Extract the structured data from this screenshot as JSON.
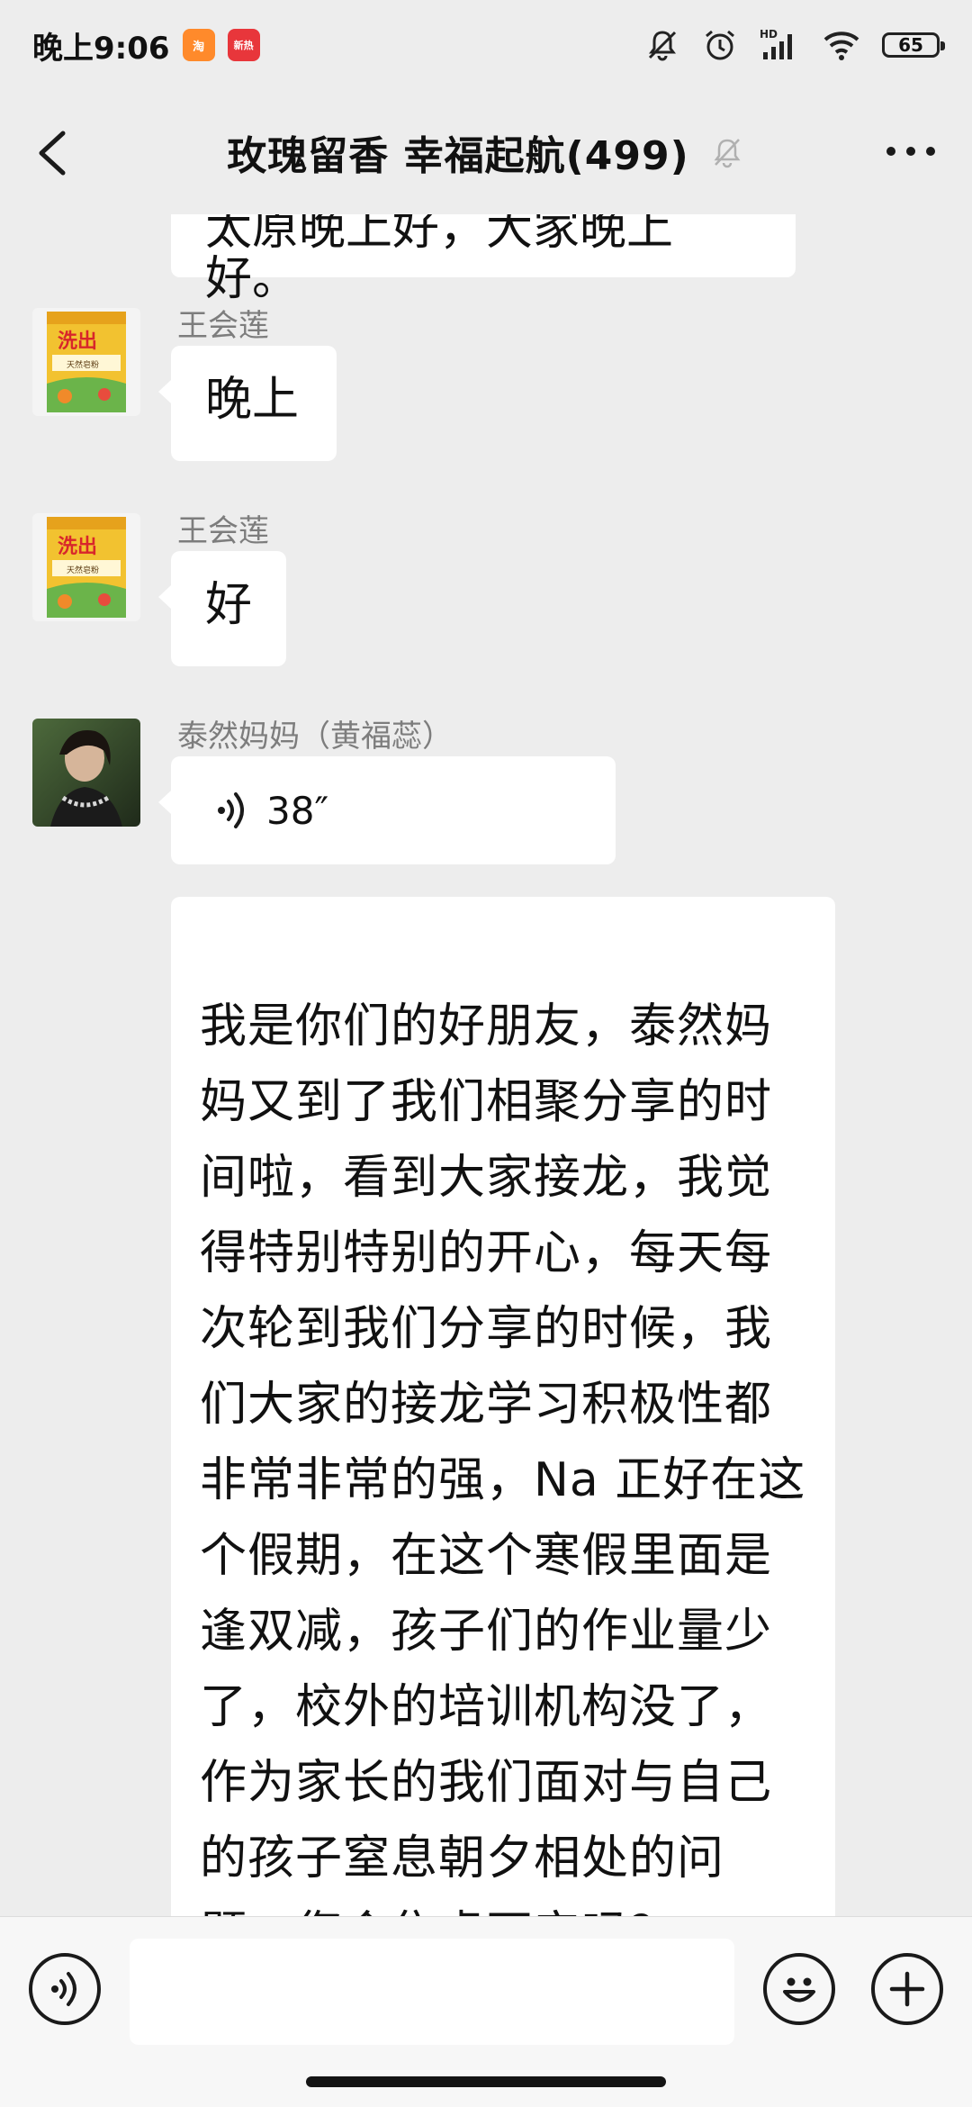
{
  "status_bar": {
    "time": "晚上9:06",
    "app_badges": [
      {
        "name": "taobao-app-icon",
        "color": "#ff8a2b",
        "text": "淘"
      },
      {
        "name": "news-app-icon",
        "color": "#e8363b",
        "text": "新热"
      }
    ],
    "icons": [
      "mute-icon",
      "alarm-icon",
      "signal-hd-icon",
      "wifi-icon"
    ],
    "battery": "65"
  },
  "nav": {
    "title": "玫瑰留香  幸福起航(499)",
    "icons": [
      "back-icon",
      "muted-bell-icon",
      "more-icon"
    ]
  },
  "messages": [
    {
      "type": "text",
      "text": "太原晚上好，大家晚上好。"
    },
    {
      "type": "text",
      "sender": "王会莲",
      "avatar": "rice-bag-avatar",
      "text": "晚上"
    },
    {
      "type": "text",
      "sender": "王会莲",
      "avatar": "rice-bag-avatar",
      "text": "好"
    },
    {
      "type": "voice",
      "sender": "泰然妈妈（黄福蕊）",
      "avatar": "woman-photo-avatar",
      "duration": "38″"
    },
    {
      "type": "text",
      "text": "我是你们的好朋友，泰然妈妈又到了我们相聚分享的时间啦，看到大家接龙，我觉得特别特别的开心，每天每次轮到我们分享的时候，我们大家的接龙学习积极性都非常非常的强，Na 正好在这个假期，在这个寒假里面是逢双减，孩子们的作业量少了，校外的培训机构没了，作为家长的我们面对与自己的孩子窒息朝夕相处的问题，您会焦虑不安吗？"
    }
  ],
  "input_bar": {
    "placeholder": "",
    "icons": [
      "voice-input-icon",
      "emoji-icon",
      "plus-icon"
    ]
  },
  "colors": {
    "background": "#ededed",
    "bubble": "#ffffff",
    "sender_name": "#7d7d7d"
  }
}
